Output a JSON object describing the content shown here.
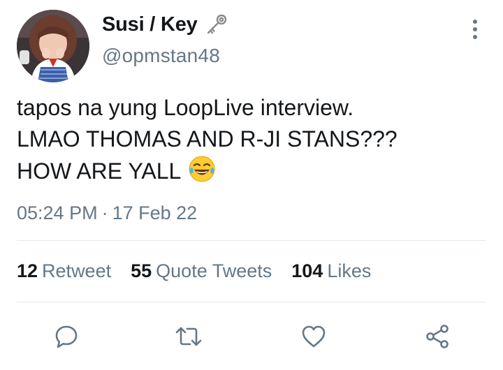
{
  "tweet": {
    "author": {
      "display_name": "Susi / Key",
      "name_emoji": "old-key-emoji",
      "handle": "@opmstan48"
    },
    "text_lines": [
      "tapos na yung LoopLive interview.",
      "LMAO THOMAS AND R-JI STANS???",
      "HOW ARE YALL"
    ],
    "text_emoji": "face-with-tears-of-joy-emoji",
    "time": "05:24 PM",
    "separator": "·",
    "date": "17 Feb 22",
    "stats": {
      "retweets": {
        "count": "12",
        "label": "Retweet"
      },
      "quote_tweets": {
        "count": "55",
        "label": "Quote Tweets"
      },
      "likes": {
        "count": "104",
        "label": "Likes"
      }
    },
    "actions": [
      "reply-icon",
      "retweet-icon",
      "like-icon",
      "share-icon"
    ]
  },
  "colors": {
    "primary_text": "#14171a",
    "secondary_text": "#657786",
    "divider": "#e1e8ed",
    "background": "#ffffff"
  }
}
